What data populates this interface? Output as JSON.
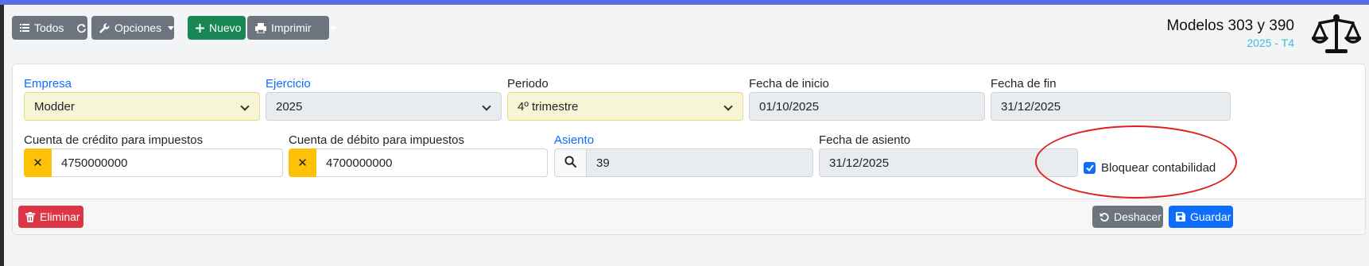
{
  "toolbar": {
    "todos_label": "Todos",
    "opciones_label": "Opciones",
    "nuevo_label": "Nuevo",
    "imprimir_label": "Imprimir"
  },
  "header": {
    "title": "Modelos 303 y 390",
    "subtitle": "2025 - T4"
  },
  "form": {
    "empresa": {
      "label": "Empresa",
      "value": "Modder"
    },
    "ejercicio": {
      "label": "Ejercicio",
      "value": "2025"
    },
    "periodo": {
      "label": "Periodo",
      "value": "4º trimestre"
    },
    "fecha_inicio": {
      "label": "Fecha de inicio",
      "value": "01/10/2025"
    },
    "fecha_fin": {
      "label": "Fecha de fin",
      "value": "31/12/2025"
    },
    "cuenta_credito": {
      "label": "Cuenta de crédito para impuestos",
      "value": "4750000000"
    },
    "cuenta_debito": {
      "label": "Cuenta de débito para impuestos",
      "value": "4700000000"
    },
    "asiento": {
      "label": "Asiento",
      "value": "39"
    },
    "fecha_asiento": {
      "label": "Fecha de asiento",
      "value": "31/12/2025"
    },
    "bloquear": {
      "label": "Bloquear contabilidad",
      "checked": true
    },
    "clear_glyph": "✕"
  },
  "footer": {
    "eliminar_label": "Eliminar",
    "deshacer_label": "Deshacer",
    "guardar_label": "Guardar"
  },
  "colors": {
    "accent": "#0d6efd",
    "secondary": "#6c757d",
    "success": "#198754",
    "danger": "#dc3545",
    "warning": "#ffc107",
    "subtitle": "#3ac0d6",
    "highlight_ellipse": "#e01e1e"
  }
}
